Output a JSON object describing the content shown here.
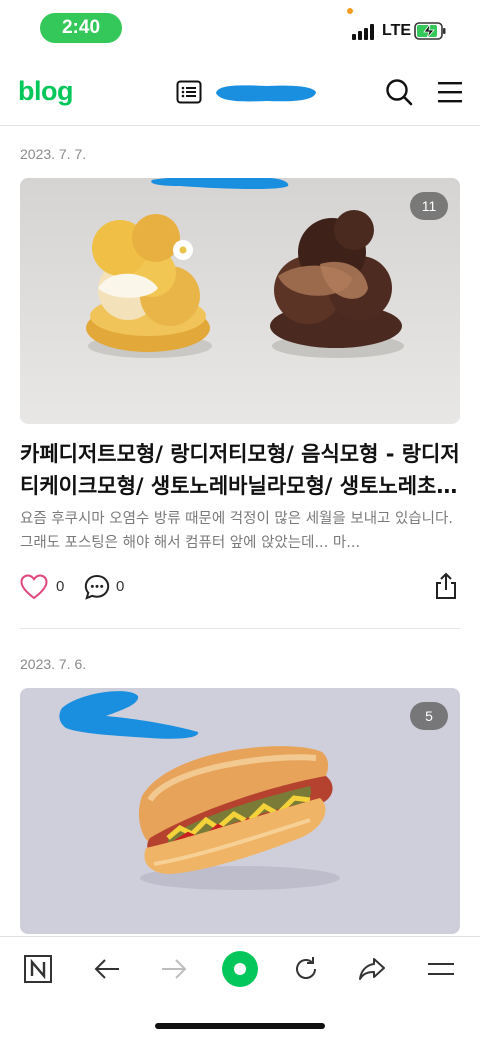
{
  "status_bar": {
    "time": "2:40",
    "network": "LTE"
  },
  "header": {
    "logo": "blog",
    "blog_name": ""
  },
  "posts": [
    {
      "date": "2023. 7. 7.",
      "photo_count": "11",
      "title": "카페디저트모형/ 랑디저티모형/ 음식모형 - 랑디저티케이크모형/ 생토노레바닐라모형/ 생토노레초…",
      "excerpt": "요즘 후쿠시마 오염수 방류 때문에 걱정이 많은 세월을 보내고 있습니다. 그래도 포스팅은 해야 해서 컴퓨터 앞에 앉았는데... 마...",
      "likes": "0",
      "comments": "0"
    },
    {
      "date": "2023. 7. 6.",
      "photo_count": "5"
    }
  ],
  "icons": {
    "list": "list-icon",
    "search": "search-icon",
    "menu": "menu-icon",
    "like": "heart-icon",
    "comment": "comment-bubble-icon",
    "share": "share-icon"
  },
  "toolbar": {
    "items": [
      "naver-home-icon",
      "back-arrow-icon",
      "forward-arrow-icon",
      "green-dot-icon",
      "refresh-icon",
      "share-arrow-icon",
      "menu-icon"
    ]
  },
  "colors": {
    "brand_green": "#03c75a",
    "status_green": "#34c759",
    "like_pink": "#e0457b",
    "mask_blue": "#1a8fe0"
  }
}
